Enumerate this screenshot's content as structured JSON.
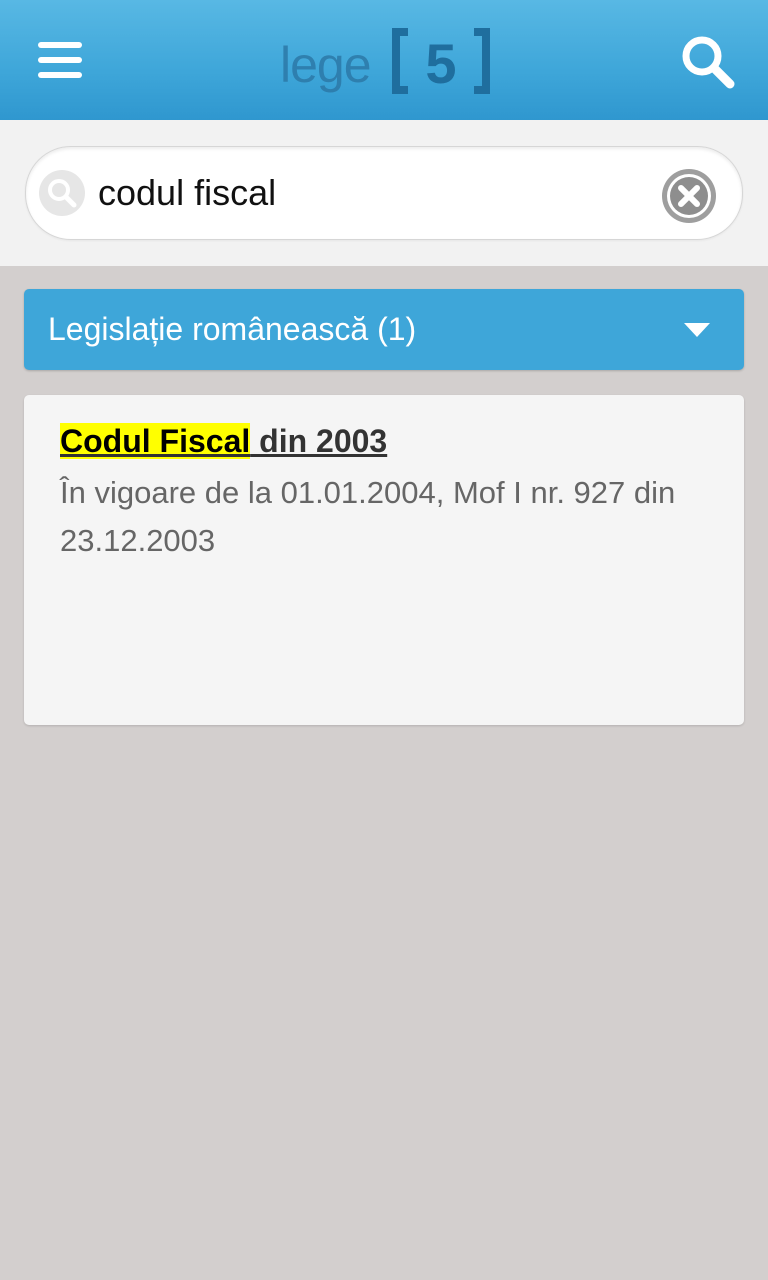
{
  "app": {
    "logo_text": "lege",
    "logo_mark": "5"
  },
  "search": {
    "value": "codul fiscal",
    "placeholder": ""
  },
  "sections": [
    {
      "label": "Legislație românească (1)",
      "results": [
        {
          "title_highlight": "Codul Fiscal",
          "title_rest": " din 2003",
          "description": "În vigoare de la 01.01.2004, Mof I nr. 927 din 23.12.2003"
        }
      ]
    }
  ],
  "icons": {
    "menu": "hamburger-menu-icon",
    "search": "magnifier-icon",
    "clear": "clear-x-icon",
    "expand": "chevron-down-icon"
  },
  "colors": {
    "topbar": "#3ea6d9",
    "section_header": "#3ea6d9",
    "highlight": "#ffff00",
    "background": "#d3cfce"
  }
}
